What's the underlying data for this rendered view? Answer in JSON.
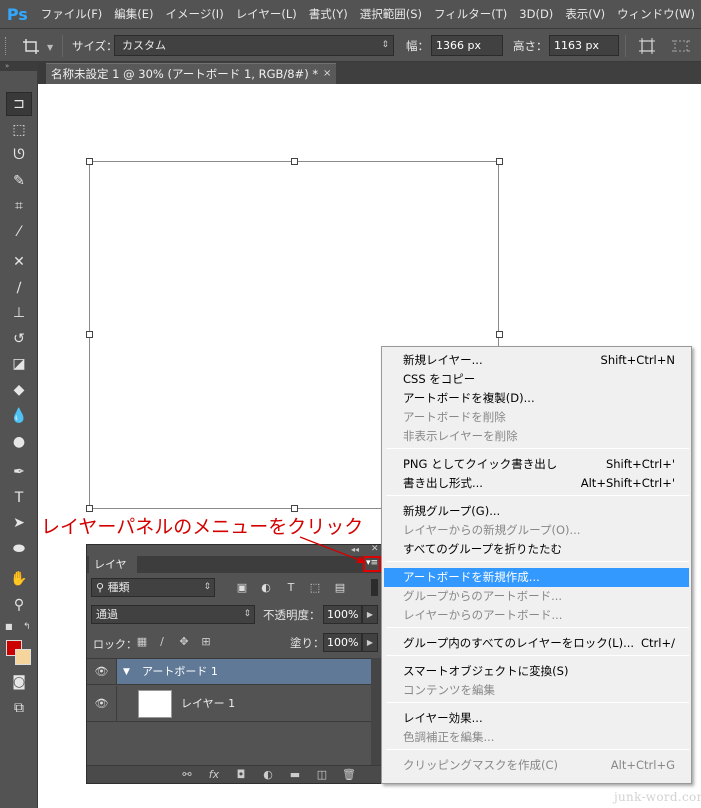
{
  "menubar": {
    "logo": "Ps",
    "items": [
      "ファイル(F)",
      "編集(E)",
      "イメージ(I)",
      "レイヤー(L)",
      "書式(Y)",
      "選択範囲(S)",
      "フィルター(T)",
      "3D(D)",
      "表示(V)",
      "ウィンドウ(W)"
    ]
  },
  "options": {
    "size_label": "サイズ：",
    "size_value": "カスタム",
    "width_label": "幅：",
    "width_value": "1366 px",
    "height_label": "高さ：",
    "height_value": "1163 px"
  },
  "document": {
    "tab_title": "名称未設定 1 @ 30% (アートボード 1, RGB/8#) *",
    "close_glyph": "×"
  },
  "annotation": {
    "text": "レイヤーパネルのメニューをクリック",
    "color": "#d40000"
  },
  "layers_panel": {
    "tab": "レイヤー",
    "filter_value": "種類",
    "blend_mode": "通過",
    "opacity_label": "不透明度：",
    "opacity_value": "100%",
    "lock_label": "ロック：",
    "fill_label": "塗り：",
    "fill_value": "100%",
    "layers": [
      {
        "name": "アートボード 1",
        "type": "artboard",
        "selected": true
      },
      {
        "name": "レイヤー 1",
        "type": "layer",
        "selected": false
      }
    ]
  },
  "context_menu": {
    "items": [
      {
        "label": "新規レイヤー...",
        "shortcut": "Shift+Ctrl+N",
        "enabled": true
      },
      {
        "label": "CSS をコピー",
        "shortcut": "",
        "enabled": true
      },
      {
        "label": "アートボードを複製(D)...",
        "shortcut": "",
        "enabled": true
      },
      {
        "label": "アートボードを削除",
        "shortcut": "",
        "enabled": false
      },
      {
        "label": "非表示レイヤーを削除",
        "shortcut": "",
        "enabled": false
      },
      {
        "label": "PNG としてクイック書き出し",
        "shortcut": "Shift+Ctrl+'",
        "enabled": true
      },
      {
        "label": "書き出し形式...",
        "shortcut": "Alt+Shift+Ctrl+'",
        "enabled": true
      },
      {
        "label": "新規グループ(G)...",
        "shortcut": "",
        "enabled": true
      },
      {
        "label": "レイヤーからの新規グループ(O)...",
        "shortcut": "",
        "enabled": false
      },
      {
        "label": "すべてのグループを折りたたむ",
        "shortcut": "",
        "enabled": true
      },
      {
        "label": "アートボードを新規作成...",
        "shortcut": "",
        "enabled": true,
        "highlighted": true
      },
      {
        "label": "グループからのアートボード...",
        "shortcut": "",
        "enabled": false
      },
      {
        "label": "レイヤーからのアートボード...",
        "shortcut": "",
        "enabled": false
      },
      {
        "label": "グループ内のすべてのレイヤーをロック(L)...",
        "shortcut": "Ctrl+/",
        "enabled": true
      },
      {
        "label": "スマートオブジェクトに変換(S)",
        "shortcut": "",
        "enabled": true
      },
      {
        "label": "コンテンツを編集",
        "shortcut": "",
        "enabled": false
      },
      {
        "label": "レイヤー効果...",
        "shortcut": "",
        "enabled": true
      },
      {
        "label": "色調補正を編集...",
        "shortcut": "",
        "enabled": false
      },
      {
        "label": "クリッピングマスクを作成(C)",
        "shortcut": "Alt+Ctrl+G",
        "enabled": false
      }
    ]
  },
  "watermark": "junk-word.com",
  "colors": {
    "foreground": "#cc0000",
    "background": "#f5d59b",
    "highlight": "#3399ff",
    "selected_layer": "#5f7997"
  }
}
